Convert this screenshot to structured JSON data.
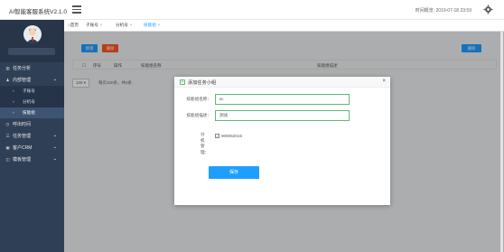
{
  "app": {
    "title": "AI智能客服系统V2.1.0",
    "clock": "时间概览: 2019-07-18 23:59"
  },
  "sidebar": {
    "items": [
      {
        "label": "任务分析",
        "icon": "chart-icon"
      },
      {
        "label": "内部管理",
        "icon": "people-icon"
      },
      {
        "label": "子账号"
      },
      {
        "label": "分机号"
      },
      {
        "label": "技能组"
      },
      {
        "label": "呼出时间",
        "icon": "clock-icon"
      },
      {
        "label": "任务管理",
        "icon": "list-icon"
      },
      {
        "label": "客户CRM",
        "icon": "crm-icon"
      },
      {
        "label": "模板管理",
        "icon": "template-icon"
      }
    ]
  },
  "tabs": [
    {
      "label": "首页"
    },
    {
      "label": "子账号"
    },
    {
      "label": "分机号"
    },
    {
      "label": "技能组"
    }
  ],
  "toolbar": {
    "add_label": "新增",
    "delete_label": "删除",
    "right_label": "删除"
  },
  "table": {
    "columns": [
      "序号",
      "操作",
      "技能组名称",
      "技能组描述"
    ]
  },
  "pager": {
    "page_size": "100",
    "info": "每页100条，共0条"
  },
  "dialog": {
    "title": "添加任务小组",
    "close": "×",
    "name_label": "技能组名称：",
    "name_value": "sc",
    "desc_label": "技能组描述：",
    "desc_value": "测试",
    "ext_label": "分机管理：",
    "ext_option": "908052015",
    "save_label": "保存"
  },
  "colors": {
    "sidebar": "#2f4056",
    "accent": "#1e9fff",
    "danger": "#ff5722",
    "green": "#5fb878"
  }
}
